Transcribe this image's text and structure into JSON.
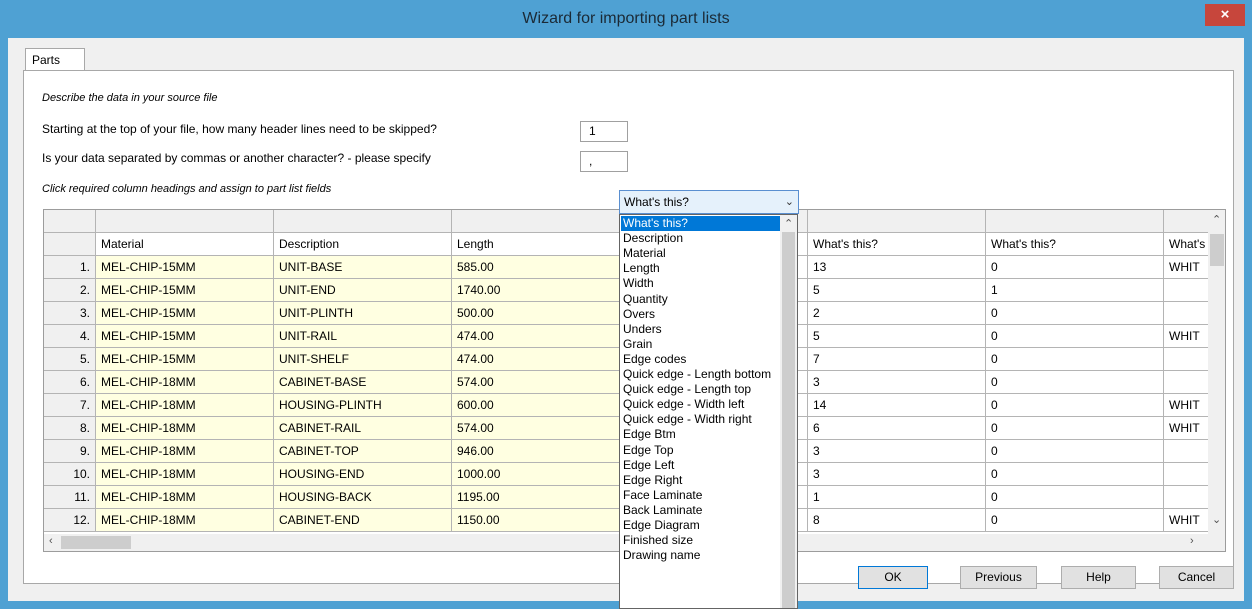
{
  "window": {
    "title": "Wizard for importing part lists",
    "close_glyph": "×"
  },
  "tabs": [
    "Parts"
  ],
  "instructions": {
    "describe": "Describe the data in your source file",
    "header_question": "Starting at the top of your file, how many header lines need to be skipped?",
    "header_value": "1",
    "separator_question": "Is your data separated by commas or another character? - please specify",
    "separator_value": ",",
    "click_hint": "Click required column headings and assign to part list fields"
  },
  "grid": {
    "headers": [
      "Material",
      "Description",
      "Length",
      "What's this?",
      "What's this?",
      "What's this?",
      "What's"
    ],
    "rows": [
      {
        "num": "1.",
        "material": "MEL-CHIP-15MM",
        "description": "UNIT-BASE",
        "length": "585.00",
        "c5": "13",
        "c6": "0",
        "c7": "WHIT"
      },
      {
        "num": "2.",
        "material": "MEL-CHIP-15MM",
        "description": "UNIT-END",
        "length": "1740.00",
        "c5": "5",
        "c6": "1",
        "c7": ""
      },
      {
        "num": "3.",
        "material": "MEL-CHIP-15MM",
        "description": "UNIT-PLINTH",
        "length": "500.00",
        "c5": "2",
        "c6": "0",
        "c7": ""
      },
      {
        "num": "4.",
        "material": "MEL-CHIP-15MM",
        "description": "UNIT-RAIL",
        "length": "474.00",
        "c5": "5",
        "c6": "0",
        "c7": "WHIT"
      },
      {
        "num": "5.",
        "material": "MEL-CHIP-15MM",
        "description": "UNIT-SHELF",
        "length": "474.00",
        "c5": "7",
        "c6": "0",
        "c7": ""
      },
      {
        "num": "6.",
        "material": "MEL-CHIP-18MM",
        "description": "CABINET-BASE",
        "length": "574.00",
        "c5": "3",
        "c6": "0",
        "c7": ""
      },
      {
        "num": "7.",
        "material": "MEL-CHIP-18MM",
        "description": "HOUSING-PLINTH",
        "length": "600.00",
        "c5": "14",
        "c6": "0",
        "c7": "WHIT"
      },
      {
        "num": "8.",
        "material": "MEL-CHIP-18MM",
        "description": "CABINET-RAIL",
        "length": "574.00",
        "c5": "6",
        "c6": "0",
        "c7": "WHIT"
      },
      {
        "num": "9.",
        "material": "MEL-CHIP-18MM",
        "description": "CABINET-TOP",
        "length": "946.00",
        "c5": "3",
        "c6": "0",
        "c7": ""
      },
      {
        "num": "10.",
        "material": "MEL-CHIP-18MM",
        "description": "HOUSING-END",
        "length": "1000.00",
        "c5": "3",
        "c6": "0",
        "c7": ""
      },
      {
        "num": "11.",
        "material": "MEL-CHIP-18MM",
        "description": "HOUSING-BACK",
        "length": "1195.00",
        "c5": "1",
        "c6": "0",
        "c7": ""
      },
      {
        "num": "12.",
        "material": "MEL-CHIP-18MM",
        "description": "CABINET-END",
        "length": "1150.00",
        "c5": "8",
        "c6": "0",
        "c7": "WHIT"
      }
    ]
  },
  "dropdown": {
    "selected": "What's this?",
    "options": [
      "What's this?",
      "Description",
      "Material",
      "Length",
      "Width",
      "Quantity",
      "Overs",
      "Unders",
      "Grain",
      "Edge codes",
      "Quick edge - Length bottom",
      "Quick edge - Length top",
      "Quick edge - Width left",
      "Quick edge - Width right",
      "Edge Btm",
      "Edge Top",
      "Edge Left",
      "Edge Right",
      "Face Laminate",
      "Back Laminate",
      "Edge Diagram",
      "Finished size",
      "Drawing name"
    ]
  },
  "buttons": {
    "ok": "OK",
    "previous": "Previous",
    "help": "Help",
    "cancel": "Cancel"
  },
  "icons": {
    "dropdown_arrow": "chevron-down-icon",
    "scroll_up": "chevron-up-icon",
    "scroll_down": "chevron-down-icon",
    "scroll_left": "chevron-left-icon",
    "scroll_right": "chevron-right-icon",
    "close": "close-icon"
  },
  "colors": {
    "title_bar": "#4fa1d3",
    "close_button": "#c7463c",
    "editable_cell": "#ffffe1",
    "selection": "#0078d7"
  }
}
